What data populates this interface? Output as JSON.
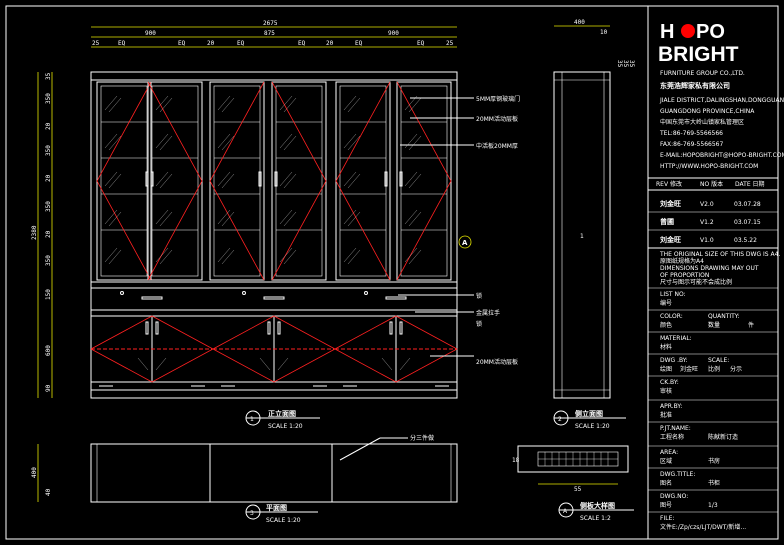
{
  "colors": {
    "background": "#000000",
    "line": "#ffffff",
    "accent": "#ff2020",
    "dimension": "#e6e600",
    "logo_dot": "#ff0000"
  },
  "logo": {
    "line1_a": "H",
    "line1_b": "PO",
    "line2": "BRIGHT",
    "group": "FURNITURE GROUP CO.,LTD.",
    "company_cn": "东莞浩辉家私有限公司"
  },
  "company_info": [
    "JIALE DISTRICT,DALINGSHAN,DONGGUAN",
    "GUANGDONG PROVINCE,CHINA",
    "中国东莞市大岭山镇家私管理区",
    "TEL:86-769-5566566",
    "FAX:86-769-5566567",
    "E-MAIL:HOPOBRIGHT@HOPO-BRIGHT.COM.CN",
    "HTTP://WWW.HOPO-BRIGHT.COM"
  ],
  "revision": {
    "header": [
      "REV 修改",
      "NO 版本",
      "DATE 日期"
    ],
    "rows": [
      [
        "刘金旺",
        "V2.0",
        "03.07.28"
      ],
      [
        "曾圃",
        "V1.2",
        "03.07.15"
      ],
      [
        "刘金旺",
        "V1.0",
        "03.5.22"
      ]
    ]
  },
  "notes": [
    "THE ORIGINAL SIZE OF THIS DWG IS A4.",
    "原图纸规格为A4",
    "DIMENSIONS DRAWING MAY OUT",
    "OF PROPORTION",
    "尺寸与图示可能不会成比例"
  ],
  "list_no": {
    "label": "LIST NO:",
    "value": "编号"
  },
  "color_row": {
    "label_en": "COLOR:",
    "label_cn": "颜色",
    "qty_en": "QUANTITY:",
    "qty_cn": "数量",
    "qty_unit": "件"
  },
  "material": {
    "label_en": "MATERIAL:",
    "label_cn": "材料"
  },
  "dwg_by": {
    "label_en": "DWG .BY:",
    "label_cn": "绘图",
    "value": "刘金旺",
    "scale_en": "SCALE:",
    "scale_cn": "比例",
    "scale_value": "分示"
  },
  "check": {
    "label_en": "CK.BY:",
    "label_cn": "审核"
  },
  "approve": {
    "label_en": "APR.BY:",
    "label_cn": "批准"
  },
  "project": {
    "label_en": "P.JT.NAME:",
    "label_cn": "工程名称",
    "value": "陈献新订造"
  },
  "area": {
    "label_en": "AREA:",
    "label_cn": "区域",
    "value": "书房"
  },
  "dwg_title": {
    "label_en": "DWG.TITLE:",
    "label_cn": "图名",
    "value": "书柜"
  },
  "dwg_no": {
    "label_en": "DWG.NO:",
    "label_cn": "图号",
    "value": "1/3"
  },
  "file": {
    "label_en": "FILE:",
    "value": "文件E:/Zp/czs/LJT/DWT/新增..."
  },
  "views": {
    "front": {
      "num": "1",
      "title": "正立面图",
      "scale": "SCALE 1:20"
    },
    "side": {
      "num": "2",
      "title": "侧立面图",
      "scale": "SCALE 1:20"
    },
    "plan": {
      "num": "3",
      "title": "平面图",
      "scale": "SCALE 1:20"
    },
    "detail": {
      "num": "A",
      "title": "侧板大样图",
      "scale": "SCALE 1:2"
    }
  },
  "annotations": {
    "glass_door": "5MM厚钢玻璃门",
    "shelf1": "20MM活动层板",
    "fixed": "中活板20MM厚",
    "lock": "锁",
    "handle": "金属拉手",
    "lock2": "锁",
    "shelf2": "20MM活动层板",
    "plan_note": "分三件做",
    "callout_a": "A"
  },
  "dims_front": {
    "total": "2675",
    "sec1": "900",
    "sec2": "875",
    "sec3": "900",
    "top_row": [
      "25",
      "EQ",
      "EQ",
      "20",
      "EQ",
      "EQ",
      "20",
      "EQ",
      "EQ",
      "25"
    ],
    "left": [
      "35",
      "80",
      "350",
      "20",
      "350",
      "20",
      "350",
      "20",
      "350",
      "20",
      "150",
      "20",
      "600",
      "90",
      "20"
    ],
    "height": "2380"
  },
  "dims_side": {
    "depth": "400",
    "val2": "10",
    "right": [
      "35",
      "35",
      "35"
    ],
    "detail_w": "55",
    "detail_h": "18"
  },
  "dims_plan": {
    "depth": "400",
    "left_small": "40"
  },
  "side_marker": "1"
}
